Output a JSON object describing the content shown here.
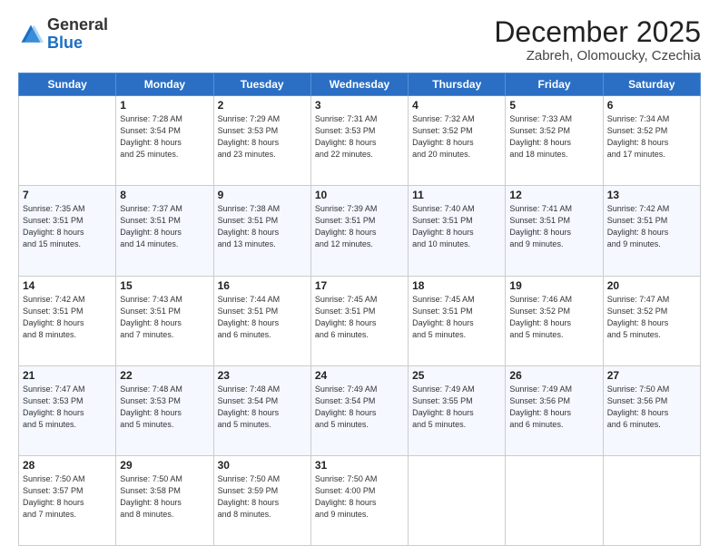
{
  "header": {
    "logo_general": "General",
    "logo_blue": "Blue",
    "month": "December 2025",
    "location": "Zabreh, Olomoucky, Czechia"
  },
  "days_of_week": [
    "Sunday",
    "Monday",
    "Tuesday",
    "Wednesday",
    "Thursday",
    "Friday",
    "Saturday"
  ],
  "weeks": [
    [
      {
        "day": "",
        "info": ""
      },
      {
        "day": "1",
        "info": "Sunrise: 7:28 AM\nSunset: 3:54 PM\nDaylight: 8 hours\nand 25 minutes."
      },
      {
        "day": "2",
        "info": "Sunrise: 7:29 AM\nSunset: 3:53 PM\nDaylight: 8 hours\nand 23 minutes."
      },
      {
        "day": "3",
        "info": "Sunrise: 7:31 AM\nSunset: 3:53 PM\nDaylight: 8 hours\nand 22 minutes."
      },
      {
        "day": "4",
        "info": "Sunrise: 7:32 AM\nSunset: 3:52 PM\nDaylight: 8 hours\nand 20 minutes."
      },
      {
        "day": "5",
        "info": "Sunrise: 7:33 AM\nSunset: 3:52 PM\nDaylight: 8 hours\nand 18 minutes."
      },
      {
        "day": "6",
        "info": "Sunrise: 7:34 AM\nSunset: 3:52 PM\nDaylight: 8 hours\nand 17 minutes."
      }
    ],
    [
      {
        "day": "7",
        "info": "Sunrise: 7:35 AM\nSunset: 3:51 PM\nDaylight: 8 hours\nand 15 minutes."
      },
      {
        "day": "8",
        "info": "Sunrise: 7:37 AM\nSunset: 3:51 PM\nDaylight: 8 hours\nand 14 minutes."
      },
      {
        "day": "9",
        "info": "Sunrise: 7:38 AM\nSunset: 3:51 PM\nDaylight: 8 hours\nand 13 minutes."
      },
      {
        "day": "10",
        "info": "Sunrise: 7:39 AM\nSunset: 3:51 PM\nDaylight: 8 hours\nand 12 minutes."
      },
      {
        "day": "11",
        "info": "Sunrise: 7:40 AM\nSunset: 3:51 PM\nDaylight: 8 hours\nand 10 minutes."
      },
      {
        "day": "12",
        "info": "Sunrise: 7:41 AM\nSunset: 3:51 PM\nDaylight: 8 hours\nand 9 minutes."
      },
      {
        "day": "13",
        "info": "Sunrise: 7:42 AM\nSunset: 3:51 PM\nDaylight: 8 hours\nand 9 minutes."
      }
    ],
    [
      {
        "day": "14",
        "info": "Sunrise: 7:42 AM\nSunset: 3:51 PM\nDaylight: 8 hours\nand 8 minutes."
      },
      {
        "day": "15",
        "info": "Sunrise: 7:43 AM\nSunset: 3:51 PM\nDaylight: 8 hours\nand 7 minutes."
      },
      {
        "day": "16",
        "info": "Sunrise: 7:44 AM\nSunset: 3:51 PM\nDaylight: 8 hours\nand 6 minutes."
      },
      {
        "day": "17",
        "info": "Sunrise: 7:45 AM\nSunset: 3:51 PM\nDaylight: 8 hours\nand 6 minutes."
      },
      {
        "day": "18",
        "info": "Sunrise: 7:45 AM\nSunset: 3:51 PM\nDaylight: 8 hours\nand 5 minutes."
      },
      {
        "day": "19",
        "info": "Sunrise: 7:46 AM\nSunset: 3:52 PM\nDaylight: 8 hours\nand 5 minutes."
      },
      {
        "day": "20",
        "info": "Sunrise: 7:47 AM\nSunset: 3:52 PM\nDaylight: 8 hours\nand 5 minutes."
      }
    ],
    [
      {
        "day": "21",
        "info": "Sunrise: 7:47 AM\nSunset: 3:53 PM\nDaylight: 8 hours\nand 5 minutes."
      },
      {
        "day": "22",
        "info": "Sunrise: 7:48 AM\nSunset: 3:53 PM\nDaylight: 8 hours\nand 5 minutes."
      },
      {
        "day": "23",
        "info": "Sunrise: 7:48 AM\nSunset: 3:54 PM\nDaylight: 8 hours\nand 5 minutes."
      },
      {
        "day": "24",
        "info": "Sunrise: 7:49 AM\nSunset: 3:54 PM\nDaylight: 8 hours\nand 5 minutes."
      },
      {
        "day": "25",
        "info": "Sunrise: 7:49 AM\nSunset: 3:55 PM\nDaylight: 8 hours\nand 5 minutes."
      },
      {
        "day": "26",
        "info": "Sunrise: 7:49 AM\nSunset: 3:56 PM\nDaylight: 8 hours\nand 6 minutes."
      },
      {
        "day": "27",
        "info": "Sunrise: 7:50 AM\nSunset: 3:56 PM\nDaylight: 8 hours\nand 6 minutes."
      }
    ],
    [
      {
        "day": "28",
        "info": "Sunrise: 7:50 AM\nSunset: 3:57 PM\nDaylight: 8 hours\nand 7 minutes."
      },
      {
        "day": "29",
        "info": "Sunrise: 7:50 AM\nSunset: 3:58 PM\nDaylight: 8 hours\nand 8 minutes."
      },
      {
        "day": "30",
        "info": "Sunrise: 7:50 AM\nSunset: 3:59 PM\nDaylight: 8 hours\nand 8 minutes."
      },
      {
        "day": "31",
        "info": "Sunrise: 7:50 AM\nSunset: 4:00 PM\nDaylight: 8 hours\nand 9 minutes."
      },
      {
        "day": "",
        "info": ""
      },
      {
        "day": "",
        "info": ""
      },
      {
        "day": "",
        "info": ""
      }
    ]
  ]
}
